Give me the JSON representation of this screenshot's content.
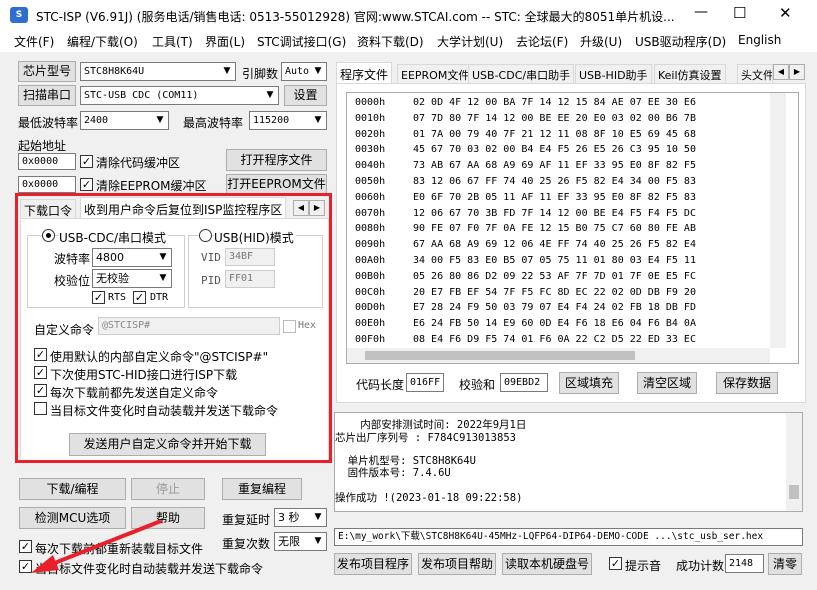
{
  "window": {
    "title": "STC-ISP (V6.91J) (服务电话/销售电话: 0513-55012928) 官网:www.STCAI.com  -- STC: 全球最大的8051单片机设...",
    "controls": [
      "—",
      "☐",
      "✕"
    ]
  },
  "menu": [
    "文件(F)",
    "编程/下载(O)",
    "工具(T)",
    "界面(L)",
    "STC调试接口(G)",
    "资料下载(D)",
    "大学计划(U)",
    "去论坛(F)",
    "升级(U)",
    "USB驱动程序(D)",
    "English"
  ],
  "left": {
    "chip_model_btn": "芯片型号",
    "chip_model": "STC8H8K64U",
    "pins_label": "引脚数",
    "pins": "Auto",
    "scan_port_btn": "扫描串口",
    "port": "STC-USB CDC (COM11)",
    "settings_btn": "设置",
    "min_baud_label": "最低波特率",
    "min_baud": "2400",
    "max_baud_label": "最高波特率",
    "max_baud": "115200",
    "start_addr_label": "起始地址",
    "addr1": "0x0000",
    "clear_code_label": "清除代码缓冲区",
    "open_prog_btn": "打开程序文件",
    "addr2": "0x0000",
    "clear_eeprom_label": "清除EEPROM缓冲区",
    "open_eeprom_btn": "打开EEPROM文件",
    "tabs": [
      "下载口令",
      "收到用户命令后复位到ISP监控程序区"
    ],
    "usb_cdc_mode": "USB-CDC/串口模式",
    "usb_hid_mode": "USB(HID)模式",
    "baud_label": "波特率",
    "baud": "4800",
    "parity_label": "校验位",
    "parity": "无校验",
    "rts_label": "RTS",
    "dtr_label": "DTR",
    "vid_label": "VID",
    "vid": "34BF",
    "pid_label": "PID",
    "pid": "FF01",
    "custom_cmd_label": "自定义命令",
    "custom_cmd": "@STCISP#",
    "hex_label": "Hex",
    "opt1": "使用默认的内部自定义命令\"@STCISP#\"",
    "opt2": "下次使用STC-HID接口进行ISP下载",
    "opt3": "每次下载前都先发送自定义命令",
    "opt4": "当目标文件变化时自动装载并发送下载命令",
    "send_btn": "发送用户自定义命令并开始下载",
    "download_btn": "下载/编程",
    "stop_btn": "停止",
    "reprog_btn": "重复编程",
    "check_mcu_btn": "检测MCU选项",
    "help_btn": "帮助",
    "repeat_delay_label": "重复延时",
    "repeat_delay": "3 秒",
    "repeat_count_label": "重复次数",
    "repeat_count": "无限",
    "reload_label": "每次下载前都重新装载目标文件",
    "auto_load_label": "当目标文件变化时自动装载并发送下载命令"
  },
  "right": {
    "tabs": [
      "程序文件",
      "EEPROM文件",
      "USB-CDC/串口助手",
      "USB-HID助手",
      "Keil仿真设置",
      "头文件"
    ],
    "hex_rows": [
      [
        "0000h",
        "02 0D 4F 12 00 BA 7F 14 12 15 84 AE 07 EE 30 E6"
      ],
      [
        "0010h",
        "07 7D 80 7F 14 12 00 BE EE 20 E0 03 02 00 B6 7B"
      ],
      [
        "0020h",
        "01 7A 00 79 40 7F 21 12 11 08 8F 10 E5 69 45 68"
      ],
      [
        "0030h",
        "45 67 70 03 02 00 B4 E4 F5 26 E5 26 C3 95 10 50"
      ],
      [
        "0040h",
        "73 AB 67 AA 68 A9 69 AF 11 EF 33 95 E0 8F 82 F5"
      ],
      [
        "0050h",
        "83 12 06 67 FF 74 40 25 26 F5 82 E4 34 00 F5 83"
      ],
      [
        "0060h",
        "E0 6F 70 2B 05 11 AF 11 EF 33 95 E0 8F 82 F5 83"
      ],
      [
        "0070h",
        "12 06 67 70 3B FD 7F 14 12 00 BE E4 F5 F4 F5 DC"
      ],
      [
        "0080h",
        "90 FE 07 F0 7F 0A FE 12 15 B0 75 C7 60 80 FE AB"
      ],
      [
        "0090h",
        "67 AA 68 A9 69 12 06 4E FF 74 40 25 26 F5 82 E4"
      ],
      [
        "00A0h",
        "34 00 F5 83 E0 B5 07 05 75 11 01 80 03 E4 F5 11"
      ],
      [
        "00B0h",
        "05 26 80 86 D2 09 22 53 AF 7F 7D 01 7F 0E E5 FC"
      ],
      [
        "00C0h",
        "20 E7 FB EF 54 7F F5 FC 8D EC 22 02 0D DB F9 20"
      ],
      [
        "00D0h",
        "E7 28 24 F9 50 03 79 07 E4 F4 24 02 FB 18 DB FD"
      ],
      [
        "00E0h",
        "E6 24 FB 50 14 E9 60 0D E4 F6 18 E6 04 F6 B4 0A"
      ],
      [
        "00F0h",
        "08 E4 F6 D9 F5 74 01 F6 0A 22 C2 D5 22 ED 33 EC"
      ]
    ],
    "code_len_label": "代码长度",
    "code_len": "016FF",
    "checksum_label": "校验和",
    "checksum": "09EBD2",
    "fill_btn": "区域填充",
    "clear_btn": "清空区域",
    "save_btn": "保存数据",
    "log": [
      "    内部安排测试时间: 2022年9月1日",
      "芯片出厂序列号 : F784C913013853",
      "",
      "  单片机型号: STC8H8K64U",
      "  固件版本号: 7.4.6U",
      "",
      "操作成功 !(2023-01-18 09:22:58)"
    ],
    "path": "E:\\my_work\\下载\\STC8H8K64U-45MHz-LQFP64-DIP64-DEMO-CODE ...\\stc_usb_ser.hex",
    "publish_btn": "发布项目程序",
    "publish_help_btn": "发布项目帮助",
    "read_disk_btn": "读取本机硬盘号",
    "beep_label": "提示音",
    "success_label": "成功计数",
    "success_count": "2148",
    "clear_count_btn": "清零"
  },
  "colors": {
    "highlight": "#e8202a",
    "arrow": "#e8202a"
  }
}
